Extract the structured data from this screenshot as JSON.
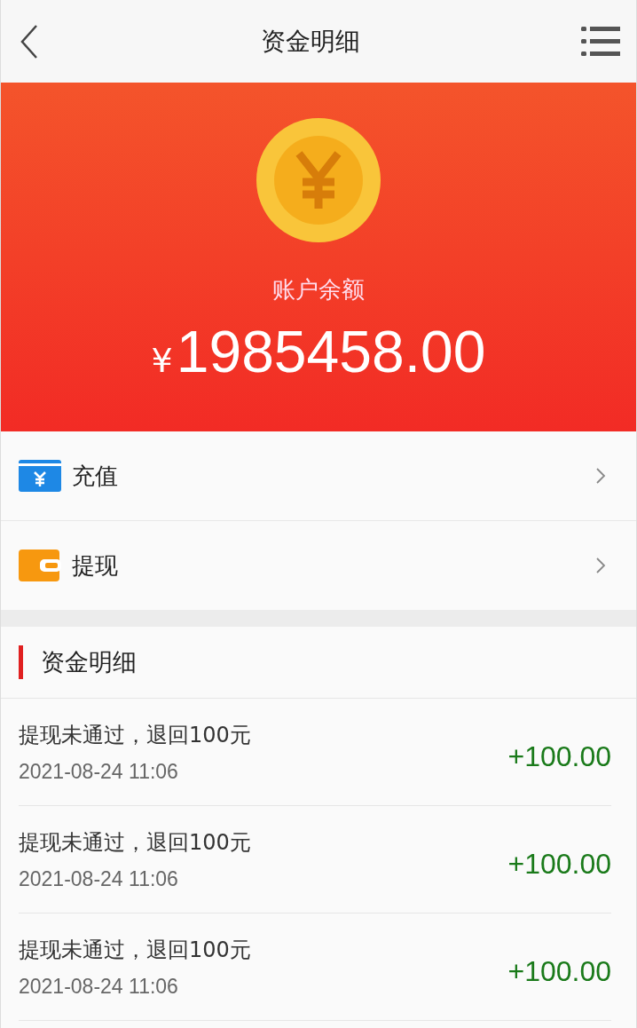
{
  "header": {
    "title": "资金明细"
  },
  "balance": {
    "label": "账户余额",
    "currency": "¥",
    "amount": "1985458.00"
  },
  "menu": [
    {
      "kind": "recharge",
      "label": "充值"
    },
    {
      "kind": "withdraw",
      "label": "提现"
    }
  ],
  "section": {
    "title": "资金明细"
  },
  "records": [
    {
      "description": "提现未通过，退回100元",
      "time": "2021-08-24 11:06",
      "amount": "+100.00"
    },
    {
      "description": "提现未通过，退回100元",
      "time": "2021-08-24 11:06",
      "amount": "+100.00"
    },
    {
      "description": "提现未通过，退回100元",
      "time": "2021-08-24 11:06",
      "amount": "+100.00"
    }
  ]
}
